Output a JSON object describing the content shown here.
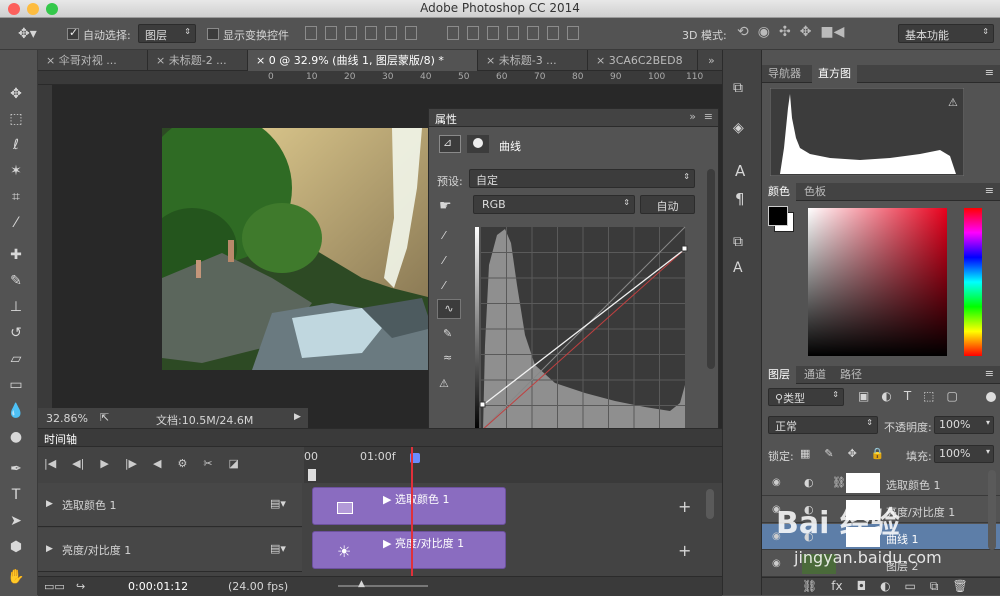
{
  "window": {
    "title": "Adobe Photoshop CC 2014"
  },
  "options": {
    "auto_select_label": "自动选择:",
    "auto_select_value": "图层",
    "show_transform_label": "显示变换控件",
    "mode3d_label": "3D 模式:",
    "workspace": "基本功能"
  },
  "tabs": [
    {
      "label": "伞哥对视 ..."
    },
    {
      "label": "未标题-2 ..."
    },
    {
      "label": "0 @ 32.9% (曲线 1, 图层蒙版/8) *"
    },
    {
      "label": "未标题-3 ..."
    },
    {
      "label": "3CA6C2BED8"
    }
  ],
  "ruler": {
    "ticks": [
      "0",
      "10",
      "20",
      "30",
      "40",
      "50",
      "60",
      "70",
      "80",
      "90",
      "100",
      "110"
    ]
  },
  "status": {
    "zoom": "32.86%",
    "doc": "文档:10.5M/24.6M"
  },
  "properties": {
    "panel_title": "属性",
    "type_label": "曲线",
    "preset_label": "预设:",
    "preset_value": "自定",
    "channel": "RGB",
    "auto_button": "自动"
  },
  "timeline": {
    "title": "时间轴",
    "time_ruler": [
      "00",
      "01:00f"
    ],
    "tracks": [
      {
        "label": "选取颜色 1",
        "clip": "选取颜色 1"
      },
      {
        "label": "亮度/对比度 1",
        "clip": "亮度/对比度 1"
      }
    ],
    "timecode": "0:00:01:12",
    "fps": "(24.00 fps)"
  },
  "right": {
    "top_tabs": [
      "导航器",
      "直方图"
    ],
    "color_tabs": [
      "颜色",
      "色板"
    ],
    "layer_tabs": [
      "图层",
      "通道",
      "路径"
    ],
    "filter_kind": "类型",
    "blend_mode": "正常",
    "opacity_label": "不透明度:",
    "opacity_value": "100%",
    "lock_label": "锁定:",
    "fill_label": "填充:",
    "fill_value": "100%",
    "layers": [
      {
        "name": "选取颜色 1"
      },
      {
        "name": "亮度/对比度 1"
      },
      {
        "name": "曲线 1"
      },
      {
        "name": "图层 2"
      }
    ]
  },
  "watermark": {
    "text": "Bai 经验",
    "url": "jingyan.baidu.com"
  }
}
